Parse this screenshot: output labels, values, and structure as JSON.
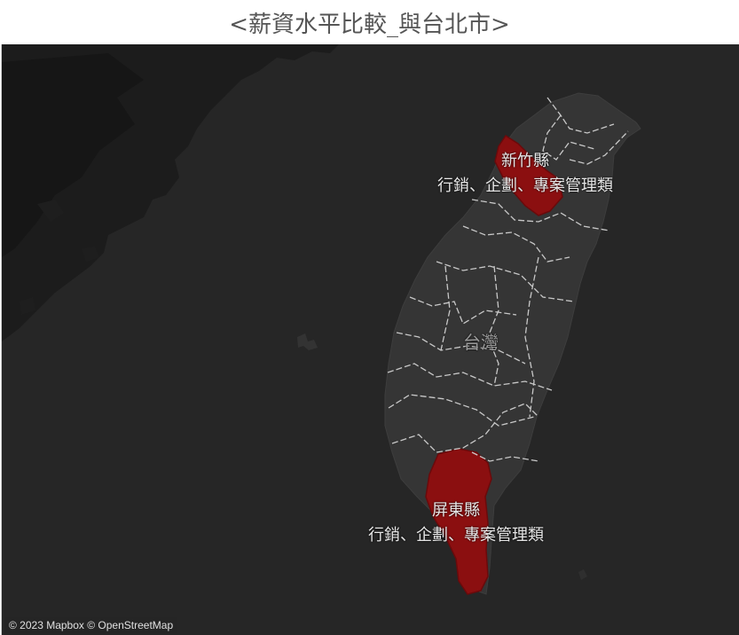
{
  "title": "<薪資水平比較_與台北市>",
  "map": {
    "island_label": "台灣",
    "highlight_color": "#8b0f10",
    "land_color": "#353535",
    "water_color": "#262626",
    "regions": [
      {
        "name": "新竹縣",
        "category": "行銷、企劃、專案管理類"
      },
      {
        "name": "屏東縣",
        "category": "行銷、企劃、專案管理類"
      }
    ],
    "attribution": "© 2023 Mapbox © OpenStreetMap"
  }
}
